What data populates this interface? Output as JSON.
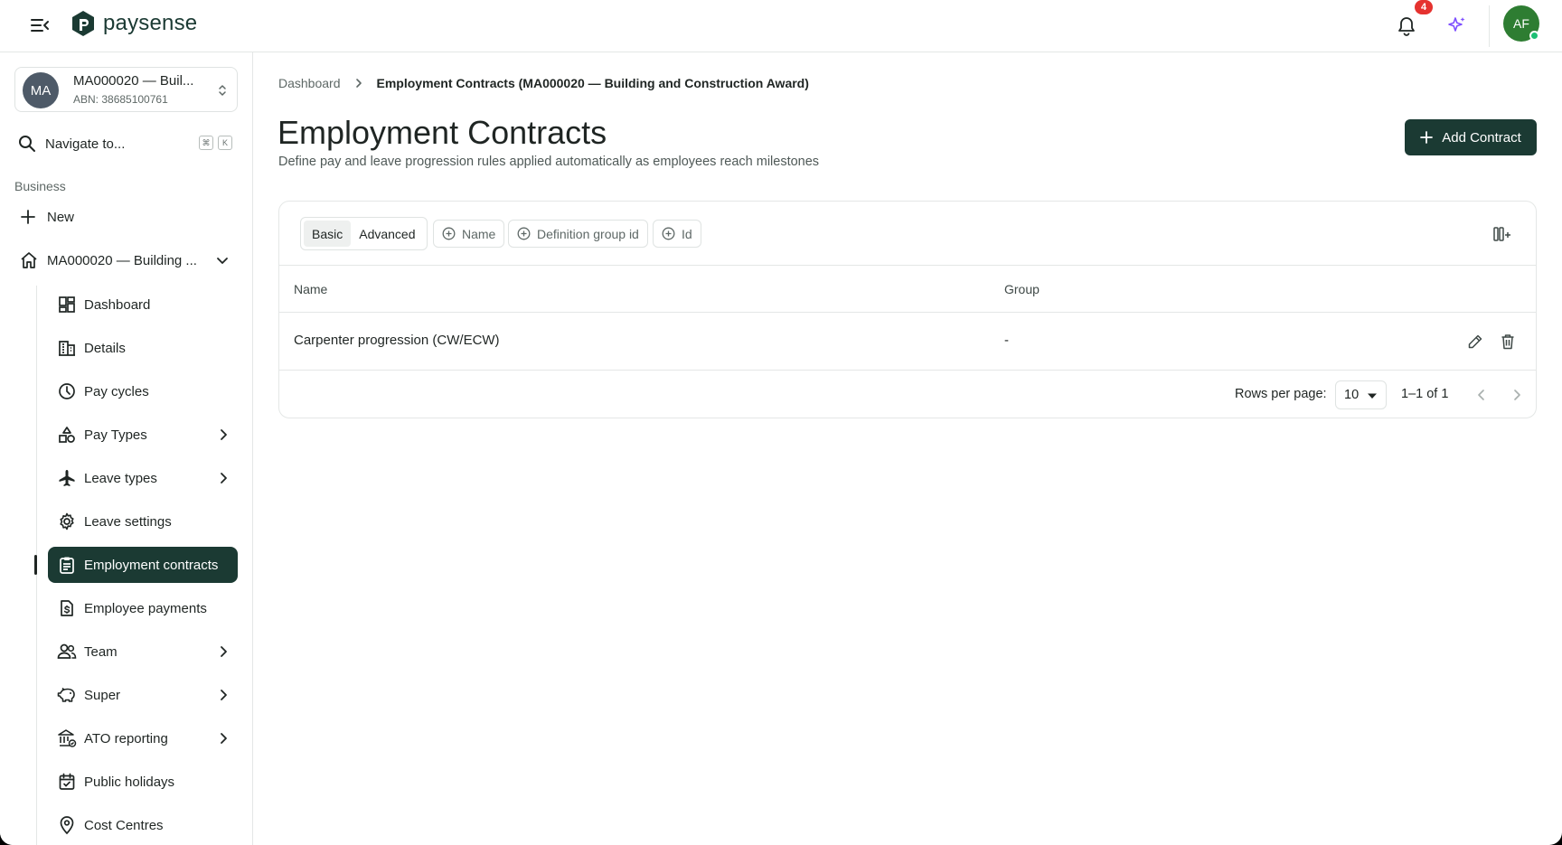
{
  "topbar": {
    "brand": "paysense",
    "notification_count": "4",
    "user_initials": "AF"
  },
  "org": {
    "initials": "MA",
    "name": "MA000020 — Buil...",
    "abn": "ABN: 38685100761"
  },
  "sidebar": {
    "navigate_label": "Navigate to...",
    "kbd_cmd": "⌘",
    "kbd_k": "K",
    "section_label": "Business",
    "new_label": "New",
    "org_item_label": "MA000020 — Building ...",
    "items": [
      {
        "label": "Dashboard",
        "icon": "dashboard-icon"
      },
      {
        "label": "Details",
        "icon": "building-icon"
      },
      {
        "label": "Pay cycles",
        "icon": "clock-icon"
      },
      {
        "label": "Pay Types",
        "icon": "shapes-icon"
      },
      {
        "label": "Leave types",
        "icon": "plane-icon"
      },
      {
        "label": "Leave settings",
        "icon": "gear-icon"
      },
      {
        "label": "Employment contracts",
        "icon": "clipboard-icon"
      },
      {
        "label": "Employee payments",
        "icon": "dollar-file-icon"
      },
      {
        "label": "Team",
        "icon": "team-icon"
      },
      {
        "label": "Super",
        "icon": "piggy-bank-icon"
      },
      {
        "label": "ATO reporting",
        "icon": "bank-icon"
      },
      {
        "label": "Public holidays",
        "icon": "calendar-icon"
      },
      {
        "label": "Cost Centres",
        "icon": "location-icon"
      }
    ]
  },
  "breadcrumb": {
    "root": "Dashboard",
    "current": "Employment Contracts (MA000020 — Building and Construction Award)"
  },
  "page": {
    "title": "Employment Contracts",
    "subtitle": "Define pay and leave progression rules applied automatically as employees reach milestones",
    "add_button": "Add Contract"
  },
  "filters": {
    "basic": "Basic",
    "advanced": "Advanced",
    "chips": [
      "Name",
      "Definition group id",
      "Id"
    ]
  },
  "table": {
    "columns": [
      "Name",
      "Group"
    ],
    "rows": [
      {
        "name": "Carpenter progression (CW/ECW)",
        "group": "-"
      }
    ]
  },
  "pagination": {
    "rows_per_page_label": "Rows per page:",
    "rows_per_page_value": "10",
    "range": "1–1 of 1"
  },
  "colors": {
    "brand_dark": "#1b3a33",
    "badge_red": "#e5322f",
    "avatar_green": "#2e7d32",
    "sparkle_purple": "#7c4dff"
  }
}
